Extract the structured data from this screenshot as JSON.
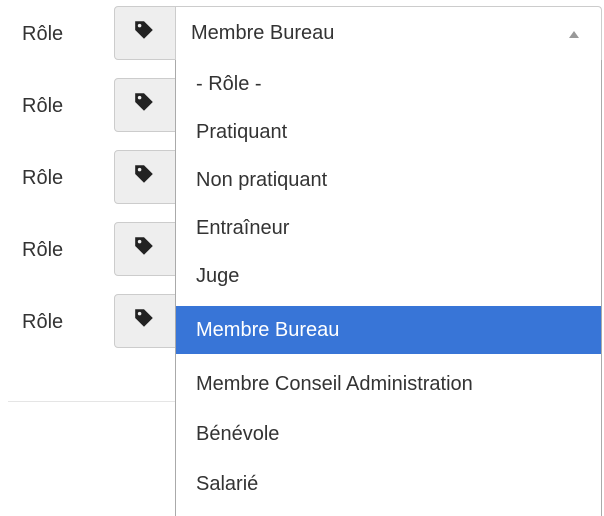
{
  "roles": [
    {
      "label": "Rôle"
    },
    {
      "label": "Rôle"
    },
    {
      "label": "Rôle"
    },
    {
      "label": "Rôle"
    },
    {
      "label": "Rôle"
    }
  ],
  "select": {
    "value": "Membre Bureau",
    "icon": "tag-icon",
    "options": [
      {
        "label": "- Rôle -",
        "selected": false
      },
      {
        "label": "Pratiquant",
        "selected": false
      },
      {
        "label": "Non pratiquant",
        "selected": false
      },
      {
        "label": "Entraîneur",
        "selected": false
      },
      {
        "label": "Juge",
        "selected": false
      },
      {
        "label": "Membre Bureau",
        "selected": true
      },
      {
        "label": "Membre Conseil Administration",
        "selected": false
      },
      {
        "label": "Bénévole",
        "selected": false
      },
      {
        "label": "Salarié",
        "selected": false
      }
    ]
  },
  "colors": {
    "highlight": "#3875d7",
    "addon_bg": "#eeeeee",
    "border": "#cccccc",
    "text": "#333333"
  }
}
